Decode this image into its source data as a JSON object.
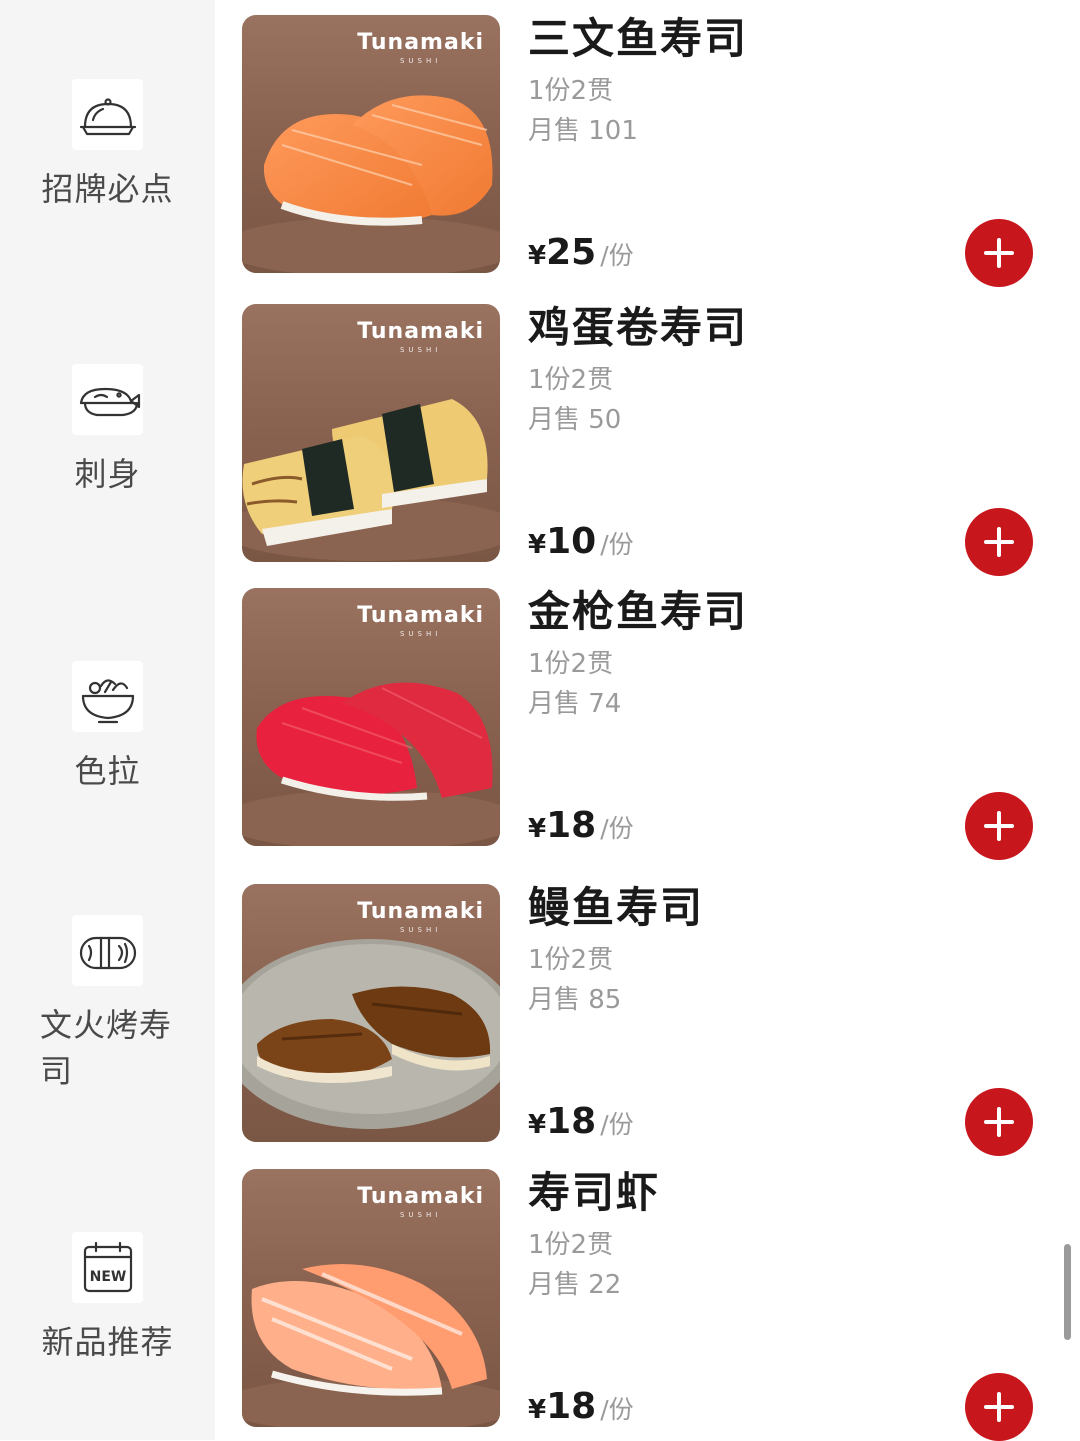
{
  "sidebar": {
    "categories": [
      {
        "label": "招牌必点",
        "icon": "cloche-icon"
      },
      {
        "label": "刺身",
        "icon": "fish-plate-icon"
      },
      {
        "label": "色拉",
        "icon": "salad-bowl-icon"
      },
      {
        "label": "文火烤寿司",
        "icon": "sushi-roll-icon"
      },
      {
        "label": "新品推荐",
        "icon": "new-calendar-icon",
        "badge": "NEW"
      }
    ]
  },
  "items": [
    {
      "name": "三文鱼寿司",
      "spec": "1份2贯",
      "sales": "月售 101",
      "currency": "¥",
      "price": "25",
      "unit": "/份",
      "brand": "Tunamaki",
      "brand_sub": "SUSHI",
      "image": "salmon-sushi-image"
    },
    {
      "name": "鸡蛋卷寿司",
      "spec": "1份2贯",
      "sales": "月售 50",
      "currency": "¥",
      "price": "10",
      "unit": "/份",
      "brand": "Tunamaki",
      "brand_sub": "SUSHI",
      "image": "egg-sushi-image"
    },
    {
      "name": "金枪鱼寿司",
      "spec": "1份2贯",
      "sales": "月售 74",
      "currency": "¥",
      "price": "18",
      "unit": "/份",
      "brand": "Tunamaki",
      "brand_sub": "SUSHI",
      "image": "tuna-sushi-image"
    },
    {
      "name": "鳗鱼寿司",
      "spec": "1份2贯",
      "sales": "月售 85",
      "currency": "¥",
      "price": "18",
      "unit": "/份",
      "brand": "Tunamaki",
      "brand_sub": "SUSHI",
      "image": "eel-sushi-image"
    },
    {
      "name": "寿司虾",
      "spec": "1份2贯",
      "sales": "月售 22",
      "currency": "¥",
      "price": "18",
      "unit": "/份",
      "brand": "Tunamaki",
      "brand_sub": "SUSHI",
      "image": "shrimp-sushi-image"
    }
  ],
  "colors": {
    "accent": "#c8161d",
    "sidebar_bg": "#f5f5f5",
    "muted_text": "#9a9a9a"
  }
}
